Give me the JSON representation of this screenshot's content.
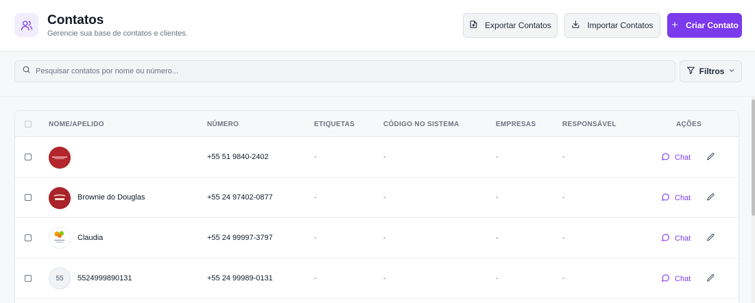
{
  "header": {
    "title": "Contatos",
    "subtitle": "Gerencie sua base de contatos e clientes.",
    "icon": "users-icon"
  },
  "toolbar": {
    "export_label": "Exportar Contatos",
    "import_label": "Importar Contatos",
    "create_label": "Criar Contato"
  },
  "search": {
    "placeholder": "Pesquisar contatos por nome ou número...",
    "value": ""
  },
  "filters": {
    "label": "Filtros"
  },
  "table": {
    "headers": {
      "name": "NOME/APELIDO",
      "number": "NÚMERO",
      "tags": "ETIQUETAS",
      "system_code": "CÓDIGO NO SISTEMA",
      "companies": "EMPRESAS",
      "owner": "RESPONSÁVEL",
      "actions": "AÇÕES"
    },
    "rows": [
      {
        "name": "",
        "number": "+55 51 9840-2402",
        "tags": "-",
        "system_code": "-",
        "companies": "-",
        "owner": "-",
        "chat": "Chat",
        "avatar": "red-logo"
      },
      {
        "name": "Brownie do Douglas",
        "number": "+55 24 97402-0877",
        "tags": "-",
        "system_code": "-",
        "companies": "-",
        "owner": "-",
        "chat": "Chat",
        "avatar": "brownie-logo"
      },
      {
        "name": "Claudia",
        "number": "+55 24 99997-3797",
        "tags": "-",
        "system_code": "-",
        "companies": "-",
        "owner": "-",
        "chat": "Chat",
        "avatar": "flower-logo"
      },
      {
        "name": "5524999890131",
        "number": "+55 24 99989-0131",
        "tags": "-",
        "system_code": "-",
        "companies": "-",
        "owner": "-",
        "chat": "Chat",
        "avatar": "initials",
        "initials": "55"
      }
    ]
  },
  "colors": {
    "accent": "#7c3aed",
    "accent_light": "#f1edfd",
    "avatar_red": "#b3262b"
  }
}
